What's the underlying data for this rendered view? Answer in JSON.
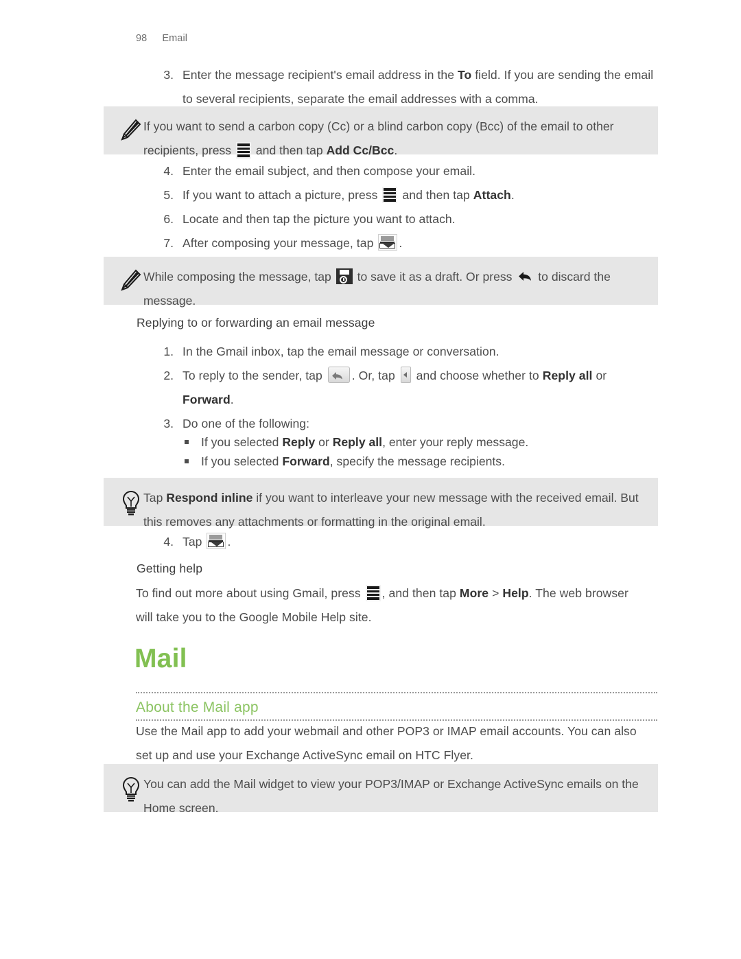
{
  "page": {
    "number": "98",
    "chapter_label": "Email",
    "accent_green": "#82c052",
    "section_green": "#8cc463",
    "note_background": "#e6e6e6",
    "body_text_color": "#4d4d4d"
  },
  "steps_compose": [
    {
      "marker": "3.",
      "parts": [
        {
          "t": "Enter the message recipient's email address in the ",
          "s": "n"
        },
        {
          "t": "To",
          "s": "b"
        },
        {
          "t": " field. If you are sending the email to several recipients, separate the email addresses with a comma.",
          "s": "n"
        }
      ]
    }
  ],
  "note_cc": {
    "icon": "pencil-icon",
    "parts": [
      {
        "t": "If you want to send a carbon copy (Cc) or a blind carbon copy (Bcc) of the email to other recipients, press ",
        "s": "n"
      },
      {
        "t": "",
        "s": "icon",
        "icon": "menu-icon"
      },
      {
        "t": " and then tap ",
        "s": "n"
      },
      {
        "t": "Add Cc/Bcc",
        "s": "b"
      },
      {
        "t": ".",
        "s": "n"
      }
    ]
  },
  "steps_compose2": [
    {
      "marker": "4.",
      "parts": [
        {
          "t": "Enter the email subject, and then compose your email.",
          "s": "n"
        }
      ]
    },
    {
      "marker": "5.",
      "parts": [
        {
          "t": "If you want to attach a picture, press ",
          "s": "n"
        },
        {
          "t": "",
          "s": "icon",
          "icon": "menu-icon"
        },
        {
          "t": " and then tap ",
          "s": "n"
        },
        {
          "t": "Attach",
          "s": "b"
        },
        {
          "t": ".",
          "s": "n"
        }
      ]
    },
    {
      "marker": "6.",
      "parts": [
        {
          "t": "Locate and then tap the picture you want to attach.",
          "s": "n"
        }
      ]
    },
    {
      "marker": "7.",
      "parts": [
        {
          "t": "After composing your message, tap ",
          "s": "n"
        },
        {
          "t": "",
          "s": "icon",
          "icon": "send-icon"
        },
        {
          "t": ".",
          "s": "n"
        }
      ]
    }
  ],
  "note_draft": {
    "icon": "pencil-icon",
    "parts": [
      {
        "t": "While composing the message, tap ",
        "s": "n"
      },
      {
        "t": "",
        "s": "icon",
        "icon": "save-icon"
      },
      {
        "t": " to save it as a draft. Or press ",
        "s": "n"
      },
      {
        "t": "",
        "s": "icon",
        "icon": "back-arrow-icon"
      },
      {
        "t": " to discard the message.",
        "s": "n"
      }
    ]
  },
  "heading_reply": "Replying to or forwarding an email message",
  "steps_reply": [
    {
      "marker": "1.",
      "parts": [
        {
          "t": "In the Gmail inbox, tap the email message or conversation.",
          "s": "n"
        }
      ]
    },
    {
      "marker": "2.",
      "parts": [
        {
          "t": "To reply to the sender, tap ",
          "s": "n"
        },
        {
          "t": "",
          "s": "icon",
          "icon": "reply-icon"
        },
        {
          "t": ". Or, tap ",
          "s": "n"
        },
        {
          "t": "",
          "s": "icon",
          "icon": "dropdown-arrow-icon"
        },
        {
          "t": " and choose whether to ",
          "s": "n"
        },
        {
          "t": "Reply all",
          "s": "b"
        },
        {
          "t": " or ",
          "s": "n"
        },
        {
          "t": "Forward",
          "s": "b"
        },
        {
          "t": ".",
          "s": "n"
        }
      ]
    },
    {
      "marker": "3.",
      "parts": [
        {
          "t": "Do one of the following:",
          "s": "n"
        }
      ]
    }
  ],
  "bullets_reply": [
    {
      "parts": [
        {
          "t": "If you selected ",
          "s": "n"
        },
        {
          "t": "Reply",
          "s": "b"
        },
        {
          "t": " or ",
          "s": "n"
        },
        {
          "t": "Reply all",
          "s": "b"
        },
        {
          "t": ", enter your reply message.",
          "s": "n"
        }
      ]
    },
    {
      "parts": [
        {
          "t": "If you selected ",
          "s": "n"
        },
        {
          "t": "Forward",
          "s": "b"
        },
        {
          "t": ", specify the message recipients.",
          "s": "n"
        }
      ]
    }
  ],
  "tip_respond": {
    "icon": "lightbulb-icon",
    "parts": [
      {
        "t": "Tap ",
        "s": "n"
      },
      {
        "t": "Respond inline",
        "s": "b"
      },
      {
        "t": " if you want to interleave your new message with the received email. But this removes any attachments or formatting in the original email.",
        "s": "n"
      }
    ]
  },
  "step_tap_send": {
    "marker": "4.",
    "parts": [
      {
        "t": "Tap ",
        "s": "n"
      },
      {
        "t": "",
        "s": "icon",
        "icon": "send-icon"
      },
      {
        "t": ".",
        "s": "n"
      }
    ]
  },
  "heading_help": "Getting help",
  "para_help": {
    "parts": [
      {
        "t": "To find out more about using Gmail, press ",
        "s": "n"
      },
      {
        "t": "",
        "s": "icon",
        "icon": "menu-icon"
      },
      {
        "t": ", and then tap ",
        "s": "n"
      },
      {
        "t": "More",
        "s": "b"
      },
      {
        "t": " > ",
        "s": "n"
      },
      {
        "t": "Help",
        "s": "b"
      },
      {
        "t": ". The web browser will take you to the Google Mobile Help site.",
        "s": "n"
      }
    ]
  },
  "chapter_title": "Mail",
  "section_title": "About the Mail app",
  "para_about": {
    "parts": [
      {
        "t": "Use the Mail app to add your webmail and other POP3 or IMAP email accounts. You can also set up and use your Exchange ActiveSync email on HTC Flyer.",
        "s": "n"
      }
    ]
  },
  "tip_widget": {
    "icon": "lightbulb-icon",
    "parts": [
      {
        "t": "You can add the Mail widget to view your POP3/IMAP or Exchange ActiveSync emails on the Home screen.",
        "s": "n"
      }
    ]
  }
}
